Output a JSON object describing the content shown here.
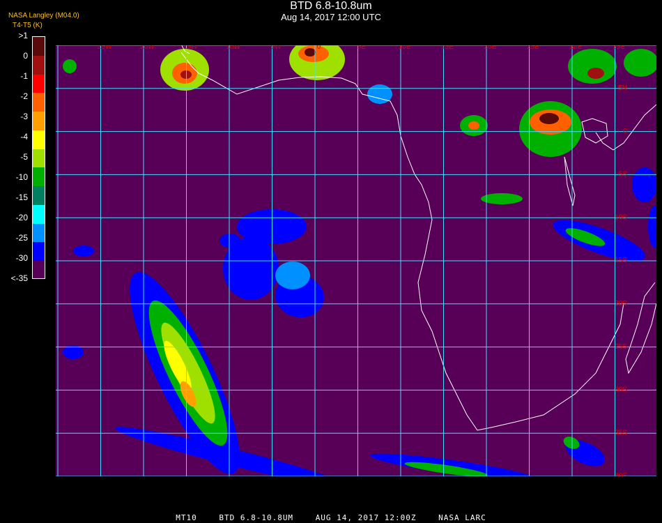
{
  "title": "BTD 6.8-10.8um",
  "datetime": "Aug 14, 2017 12:00 UTC",
  "source": "NASA Langley (M04.0)",
  "colorbar": {
    "label": "T4-T5 (K)",
    "ticks": [
      ">1",
      "0",
      "-1",
      "-2",
      "-3",
      "-4",
      "-5",
      "-10",
      "-15",
      "-20",
      "-25",
      "-30",
      "<-35"
    ],
    "colors": [
      "#5a0a0a",
      "#a01010",
      "#ff0000",
      "#ff6000",
      "#ffa000",
      "#ffff00",
      "#a0e000",
      "#00b000",
      "#008060",
      "#00ffff",
      "#0090ff",
      "#0000ff",
      "#580058"
    ]
  },
  "map": {
    "background": "#580058",
    "grid_color": "#40e0ff",
    "lon_labels": [
      "25W",
      "20W",
      "15W",
      "10W",
      "5W",
      "0",
      "5E",
      "10E",
      "15E",
      "20E",
      "25E",
      "30E",
      "35E"
    ],
    "lat_labels": [
      "5N",
      "0",
      "5S",
      "10S",
      "15S",
      "20S",
      "25S",
      "30S",
      "35S",
      "40S"
    ]
  },
  "footer": {
    "satellite": "MT10",
    "product": "BTD 6.8-10.8UM",
    "time": "AUG 14, 2017 12:00Z",
    "org": "NASA LARC"
  }
}
